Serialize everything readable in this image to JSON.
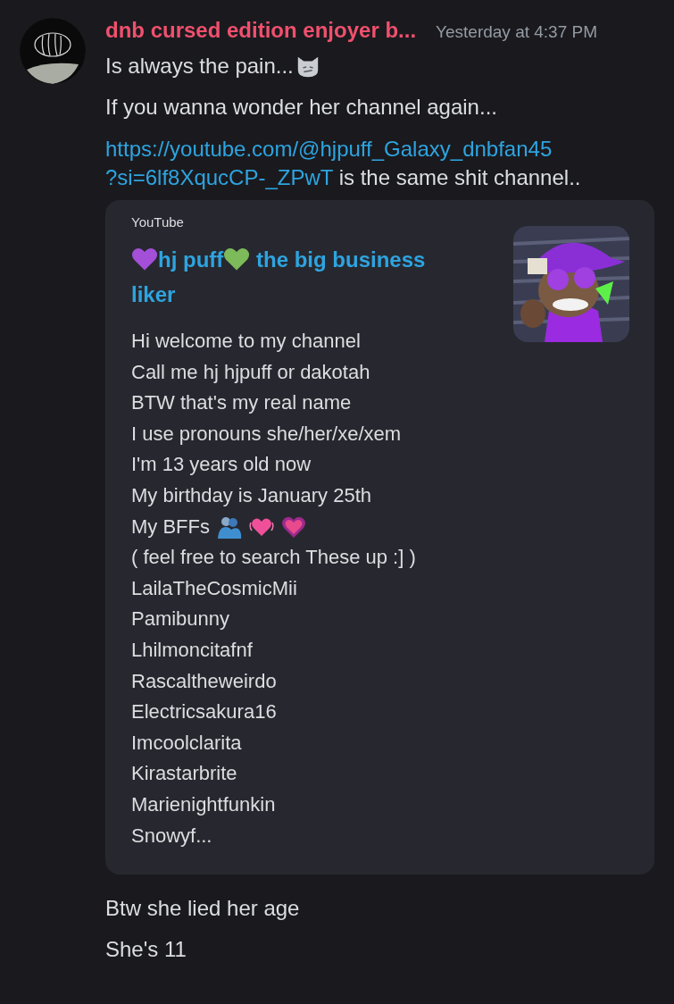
{
  "message": {
    "author": "dnb cursed edition enjoyer b...",
    "timestamp": "Yesterday at 4:37 PM",
    "lines": [
      {
        "kind": "with_emoji",
        "text": "Is always the pain..."
      },
      {
        "kind": "text",
        "text": "If you wanna wonder her channel again..."
      },
      {
        "kind": "link",
        "link": [
          "https://youtube.com/@hjpuff_Galaxy_dnbfan45",
          "?si=6lf8XqucCP-_ZPwT"
        ],
        "text": " is the same shit channel.."
      }
    ],
    "embed": {
      "provider": "YouTube",
      "title": [
        {
          "kind": "heart",
          "color": "#a34fd8"
        },
        {
          "kind": "text",
          "text": "hj puff"
        },
        {
          "kind": "heart",
          "color": "#7cba5a"
        },
        {
          "kind": "text",
          "text": " the big business liker"
        }
      ],
      "description": [
        {
          "kind": "text",
          "text": "Hi welcome to my channel"
        },
        {
          "kind": "text",
          "text": "Call me hj hjpuff or dakotah"
        },
        {
          "kind": "text",
          "text": "BTW that's my real name"
        },
        {
          "kind": "text",
          "text": "I use pronouns she/her/xe/xem"
        },
        {
          "kind": "text",
          "text": "I'm 13 years old now"
        },
        {
          "kind": "text",
          "text": "My birthday is January 25th"
        },
        {
          "kind": "emoji_line",
          "text": "My BFFs"
        },
        {
          "kind": "text",
          "text": "( feel free to search These up :] )"
        },
        {
          "kind": "text",
          "text": "LailaTheCosmicMii"
        },
        {
          "kind": "text",
          "text": "Pamibunny"
        },
        {
          "kind": "text",
          "text": "Lhilmoncitafnf"
        },
        {
          "kind": "text",
          "text": "Rascaltheweirdo"
        },
        {
          "kind": "text",
          "text": "Electricsakura16"
        },
        {
          "kind": "text",
          "text": "Imcoolclarita"
        },
        {
          "kind": "text",
          "text": "Kirastarbrite"
        },
        {
          "kind": "text",
          "text": "Marienightfunkin"
        },
        {
          "kind": "text",
          "text": "Snowyf..."
        }
      ]
    }
  },
  "followups": [
    {
      "text": "Btw she lied her age"
    },
    {
      "text": "She's 11"
    }
  ]
}
